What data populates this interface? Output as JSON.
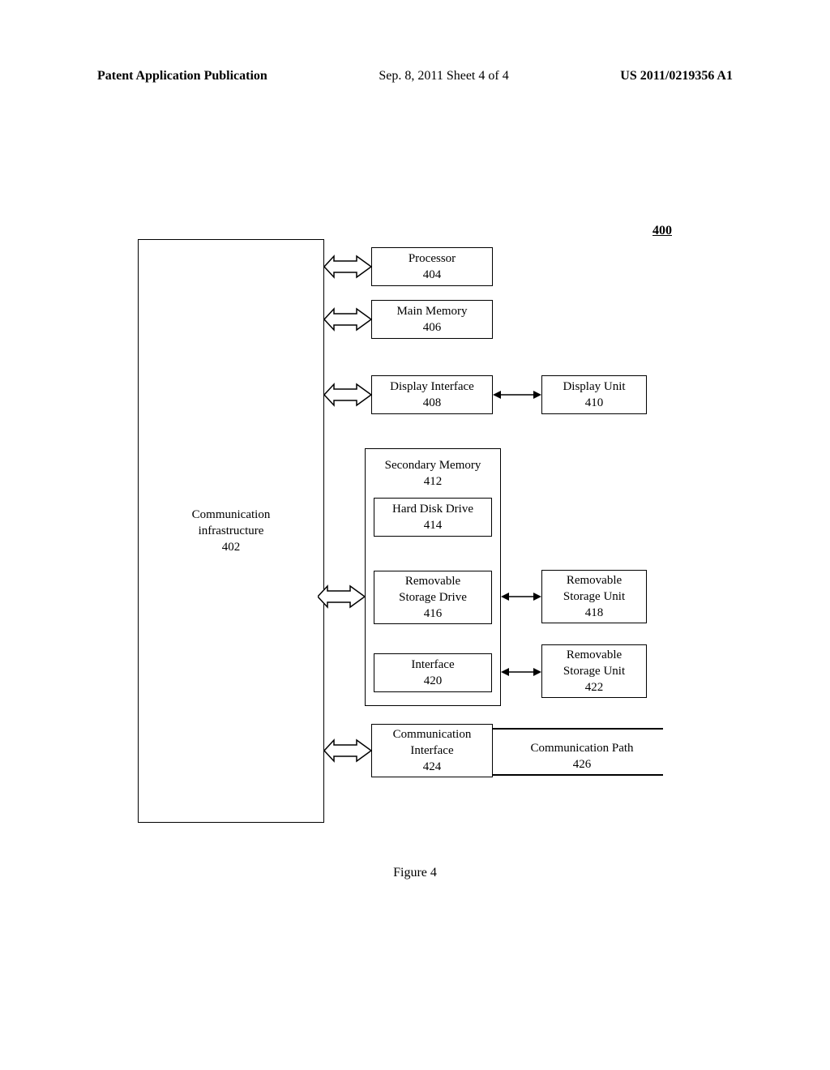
{
  "header": {
    "left": "Patent Application Publication",
    "center": "Sep. 8, 2011    Sheet 4 of 4",
    "right": "US 2011/0219356 A1"
  },
  "figure_number": "400",
  "bus": {
    "line1": "Communication",
    "line2": "infrastructure",
    "ref": "402"
  },
  "blocks": {
    "processor": {
      "label": "Processor",
      "ref": "404"
    },
    "main_memory": {
      "label": "Main Memory",
      "ref": "406"
    },
    "display_interface": {
      "label": "Display Interface",
      "ref": "408"
    },
    "display_unit": {
      "label": "Display Unit",
      "ref": "410"
    },
    "secondary_memory": {
      "label": "Secondary Memory",
      "ref": "412"
    },
    "hard_disk": {
      "label": "Hard Disk Drive",
      "ref": "414"
    },
    "removable_drive": {
      "line1": "Removable",
      "line2": "Storage Drive",
      "ref": "416"
    },
    "removable_unit_1": {
      "line1": "Removable",
      "line2": "Storage Unit",
      "ref": "418"
    },
    "interface": {
      "label": "Interface",
      "ref": "420"
    },
    "removable_unit_2": {
      "line1": "Removable",
      "line2": "Storage Unit",
      "ref": "422"
    },
    "comm_interface": {
      "line1": "Communication",
      "line2": "Interface",
      "ref": "424"
    },
    "comm_path": {
      "label": "Communication Path",
      "ref": "426"
    }
  },
  "caption": "Figure 4"
}
